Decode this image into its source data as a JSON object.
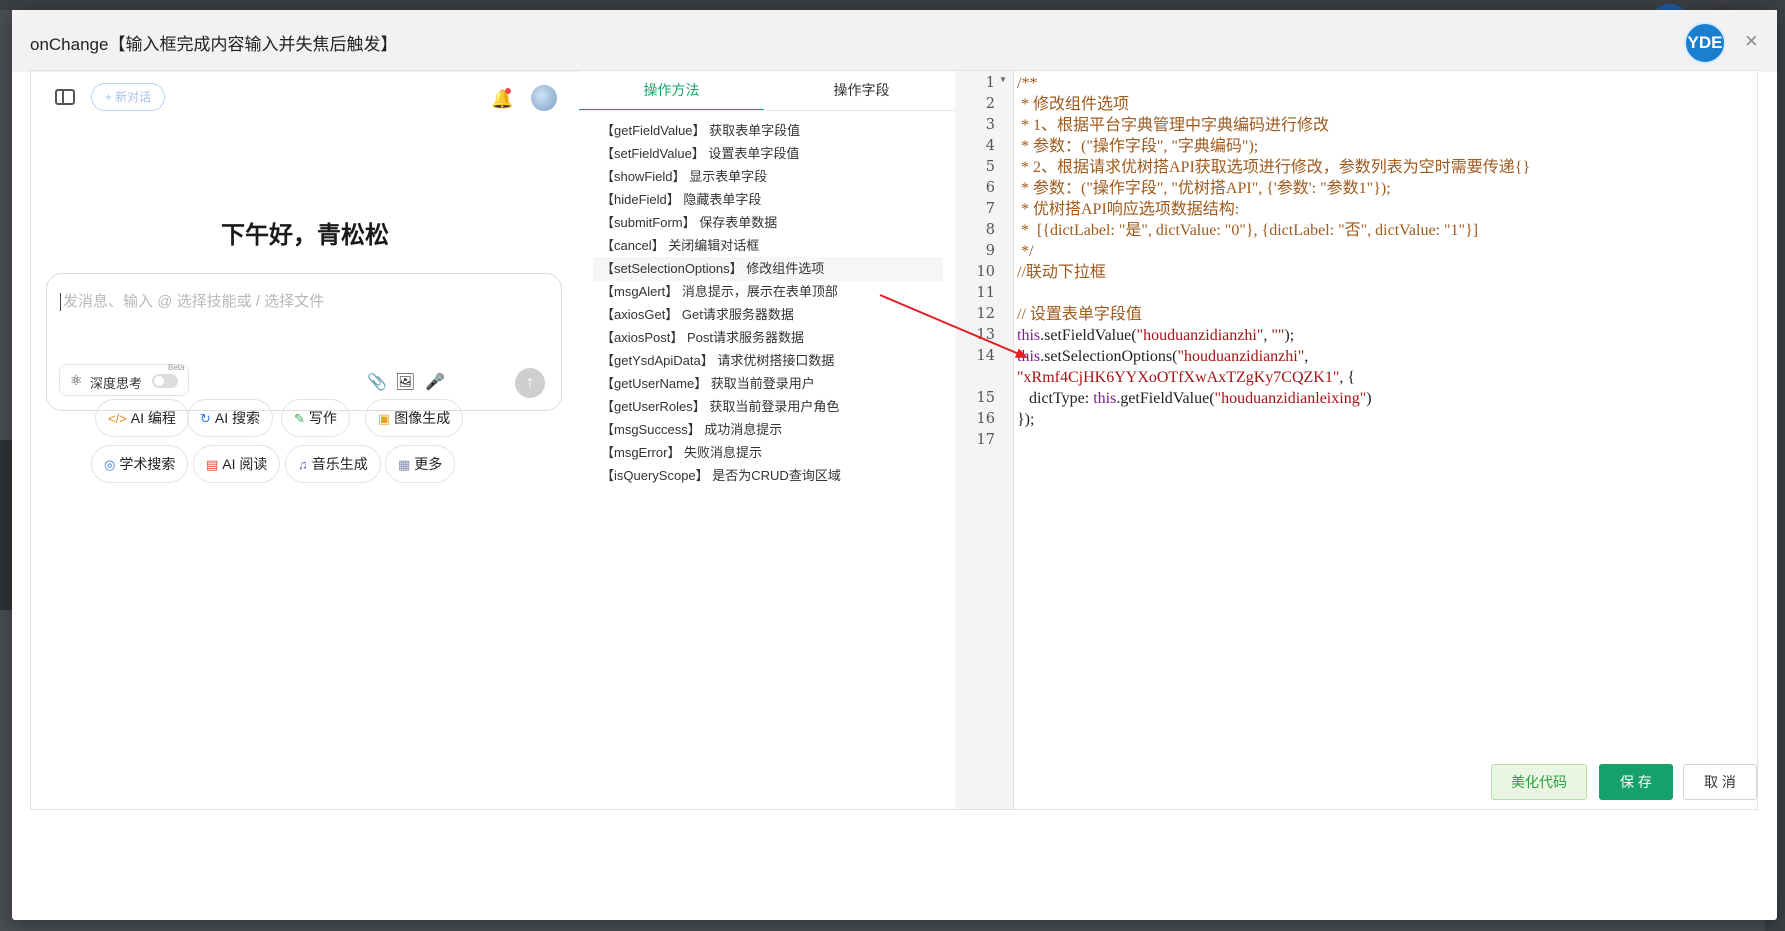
{
  "dialog": {
    "title": "onChange【输入框完成内容输入并失焦后触发】",
    "logo_text": "YDE",
    "close_symbol": "×"
  },
  "ai_panel": {
    "new_chat_label": "+ 新对话",
    "greeting": "下午好，青松松",
    "input_placeholder": "发消息、输入 @ 选择技能或 / 选择文件",
    "deep_think_label": "深度思考",
    "beta_label": "Beta",
    "chips": [
      {
        "icon": "</>",
        "label": "AI 编程",
        "color": "#e08a1e"
      },
      {
        "icon": "↻",
        "label": "AI 搜索",
        "color": "#2d7be5"
      },
      {
        "icon": "✎",
        "label": "写作",
        "color": "#2ea44f"
      },
      {
        "icon": "▣",
        "label": "图像生成",
        "color": "#e9a21a"
      },
      {
        "icon": "◎",
        "label": "学术搜索",
        "color": "#2d7be5"
      },
      {
        "icon": "▤",
        "label": "AI 阅读",
        "color": "#e2463a"
      },
      {
        "icon": "♫",
        "label": "音乐生成",
        "color": "#7b4fe0"
      },
      {
        "icon": "▦",
        "label": "更多",
        "color": "#8a8fb0"
      }
    ]
  },
  "methods_panel": {
    "tabs": [
      "操作方法",
      "操作字段"
    ],
    "items": [
      "【getFieldValue】 获取表单字段值",
      "【setFieldValue】 设置表单字段值",
      "【showField】 显示表单字段",
      "【hideField】 隐藏表单字段",
      "【submitForm】 保存表单数据",
      "【cancel】 关闭编辑对话框",
      "【setSelectionOptions】 修改组件选项",
      "【msgAlert】 消息提示，展示在表单顶部",
      "【axiosGet】 Get请求服务器数据",
      "【axiosPost】 Post请求服务器数据",
      "【getYsdApiData】 请求优树搭接口数据",
      "【getUserName】 获取当前登录用户",
      "【getUserRoles】 获取当前登录用户角色",
      "【msgSuccess】 成功消息提示",
      "【msgError】 失败消息提示",
      "【isQueryScope】 是否为CRUD查询区域"
    ]
  },
  "editor": {
    "line_numbers": [
      "1",
      "2",
      "3",
      "4",
      "5",
      "6",
      "7",
      "8",
      "9",
      "10",
      "11",
      "12",
      "13",
      "14",
      "",
      "15",
      "16",
      "17"
    ],
    "lines": {
      "l1": "/**",
      "l2": " * 修改组件选项",
      "l3": " * 1、根据平台字典管理中字典编码进行修改",
      "l4": " * 参数：(\"操作字段\", \"字典编码\");",
      "l5": " * 2、根据请求优树搭API获取选项进行修改，参数列表为空时需要传递{}",
      "l6": " * 参数：(\"操作字段\", \"优树搭API\", {'参数': \"参数1\"});",
      "l7": " * 优树搭API响应选项数据结构:",
      "l8": " *  [{dictLabel: \"是\", dictValue: \"0\"}, {dictLabel: \"否\", dictValue: \"1\"}]",
      "l9": " */",
      "l10": "//联动下拉框",
      "l12": "// 设置表单字段值",
      "l13_this": "this",
      "l13_call": ".setFieldValue(",
      "l13_arg1": "\"houduanzidianzhi\"",
      "l13_sep": ", ",
      "l13_arg2": "\"\"",
      "l13_end": ");",
      "l14_this": "this",
      "l14_call": ".setSelectionOptions(",
      "l14_arg1": "\"houduanzidianzhi\"",
      "l14_sep": ",",
      "l14b_arg2": "\"xRmf4CjHK6YYXoOTfXwAxTZgKy7CQZK1\"",
      "l14b_rest": ", {",
      "l15_key": "   dictType: ",
      "l15_this": "this",
      "l15_call": ".getFieldValue(",
      "l15_arg": "\"houduanzidianleixing\"",
      "l15_end": ")",
      "l16": "});"
    }
  },
  "footer": {
    "beautify_label": "美化代码",
    "save_label": "保 存",
    "cancel_label": "取 消"
  },
  "colors": {
    "accent_green": "#16a06c",
    "arrow_red": "#e02020",
    "comment": "#a05a1c",
    "keyword": "#7a1f8c",
    "string": "#a31515"
  }
}
